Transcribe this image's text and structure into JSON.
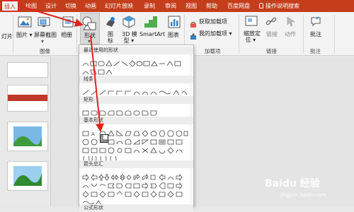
{
  "tabs": [
    "插入",
    "绘图",
    "设计",
    "切换",
    "动画",
    "幻灯片放映",
    "录制",
    "审阅",
    "视图",
    "帮助",
    "百度网盘"
  ],
  "active_tab": "插入",
  "tell_me": "操作说明搜索",
  "ribbon": {
    "new_slide": "灯片",
    "picture": "图片",
    "screenshot": "屏幕截图",
    "album": "相册",
    "shapes": "形状",
    "icons": "图\n标",
    "icons_label": "图标",
    "model3d": "3D 模\n型",
    "model3d_label": "3D 模型",
    "smartart": "SmartArt",
    "chart": "图表",
    "get_addins": "获取加载项",
    "my_addins": "我的加载项",
    "zoom": "缩放定\n位",
    "zoom_label": "缩放定位",
    "link": "链接",
    "action": "动作",
    "comment": "批注",
    "groups": {
      "images": "图像",
      "addins": "加载项",
      "links": "链接",
      "comments": "批注",
      "slides": "片"
    }
  },
  "dropdown": {
    "sections": [
      "最近使用的形状",
      "线条",
      "矩形",
      "基本形状",
      "箭头总汇",
      "公式形状"
    ]
  },
  "slide_numbers": [
    "",
    "",
    "",
    ""
  ],
  "slide_title_text": "…",
  "watermark": "Baidu 经验",
  "watermark_url": "jingyan.baidu.com",
  "colors": {
    "accent": "#c43e1c",
    "arrow": "#e0241b"
  }
}
